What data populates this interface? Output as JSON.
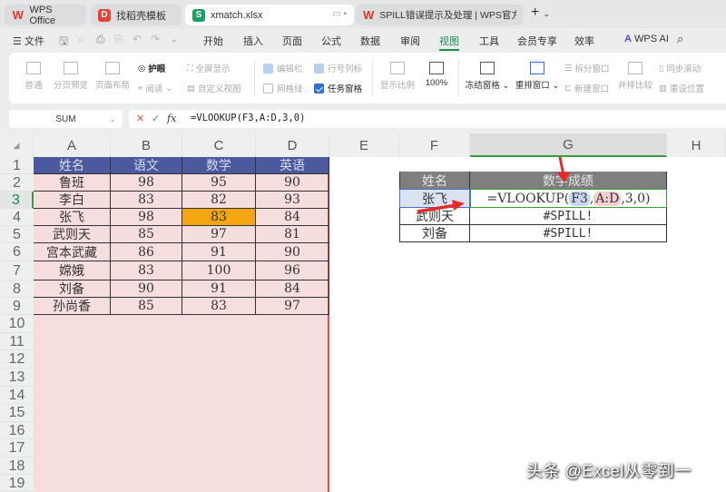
{
  "tabs": [
    {
      "label": "WPS Office",
      "icon": "wps-logo-icon"
    },
    {
      "label": "找稻壳模板",
      "icon": "docer-icon"
    },
    {
      "label": "xmatch.xlsx",
      "icon": "spreadsheet-icon",
      "active": true
    },
    {
      "label": "SPILL错误提示及处理 | WPS官方社区",
      "icon": "wps-logo-icon"
    }
  ],
  "menu": {
    "file": "文件",
    "items": [
      "开始",
      "插入",
      "页面",
      "公式",
      "数据",
      "审阅",
      "视图",
      "工具",
      "会员专享",
      "效率"
    ],
    "active": "视图",
    "ai": "WPS AI"
  },
  "ribbon": {
    "normal": "普通",
    "page_break": "分页预览",
    "page_layout": "页面布局",
    "eye_care": "护眼",
    "reading": "阅读",
    "fullscreen": "全屏显示",
    "custom_view": "自定义视图",
    "edit_bar": "编辑栏",
    "headings": "行号列标",
    "gridlines": "网格线",
    "task_pane": "任务窗格",
    "zoom": "显示比例",
    "zoom_100": "100%",
    "freeze": "冻结窗格",
    "arrange": "重排窗口",
    "split": "拆分窗口",
    "new_window": "新建窗口",
    "side_by_side": "并排比较",
    "sync_scroll": "同步滚动",
    "reset_pos": "重设位置"
  },
  "formula_bar": {
    "name_box": "SUM",
    "formula": "=VLOOKUP(F3,A:D,3,0)"
  },
  "columns": [
    "A",
    "B",
    "C",
    "D",
    "E",
    "F",
    "G",
    "H"
  ],
  "rows": [
    "1",
    "2",
    "3",
    "4",
    "5",
    "6",
    "7",
    "8",
    "9",
    "10",
    "11",
    "12",
    "13",
    "14",
    "15",
    "16",
    "17",
    "18",
    "19"
  ],
  "table": {
    "headers": [
      "姓名",
      "语文",
      "数学",
      "英语"
    ],
    "rows": [
      [
        "鲁班",
        "98",
        "95",
        "90"
      ],
      [
        "李白",
        "83",
        "82",
        "93"
      ],
      [
        "张飞",
        "98",
        "83",
        "84"
      ],
      [
        "武则天",
        "85",
        "97",
        "81"
      ],
      [
        "宫本武藏",
        "86",
        "91",
        "90"
      ],
      [
        "嫦娥",
        "83",
        "100",
        "96"
      ],
      [
        "刘备",
        "90",
        "91",
        "84"
      ],
      [
        "孙尚香",
        "85",
        "83",
        "97"
      ]
    ]
  },
  "lookup": {
    "headers": [
      "姓名",
      "数学成绩"
    ],
    "rows": [
      {
        "name": "张飞",
        "f_pre": "=VLOOKUP(",
        "ref1": "F3",
        "sep": ",",
        "ref2": "A:D",
        "f_post": ",3,0)"
      },
      {
        "name": "武则天",
        "value": "#SPILL!"
      },
      {
        "name": "刘备",
        "value": "#SPILL!"
      }
    ]
  },
  "watermark": "头条 @Excel从零到一"
}
